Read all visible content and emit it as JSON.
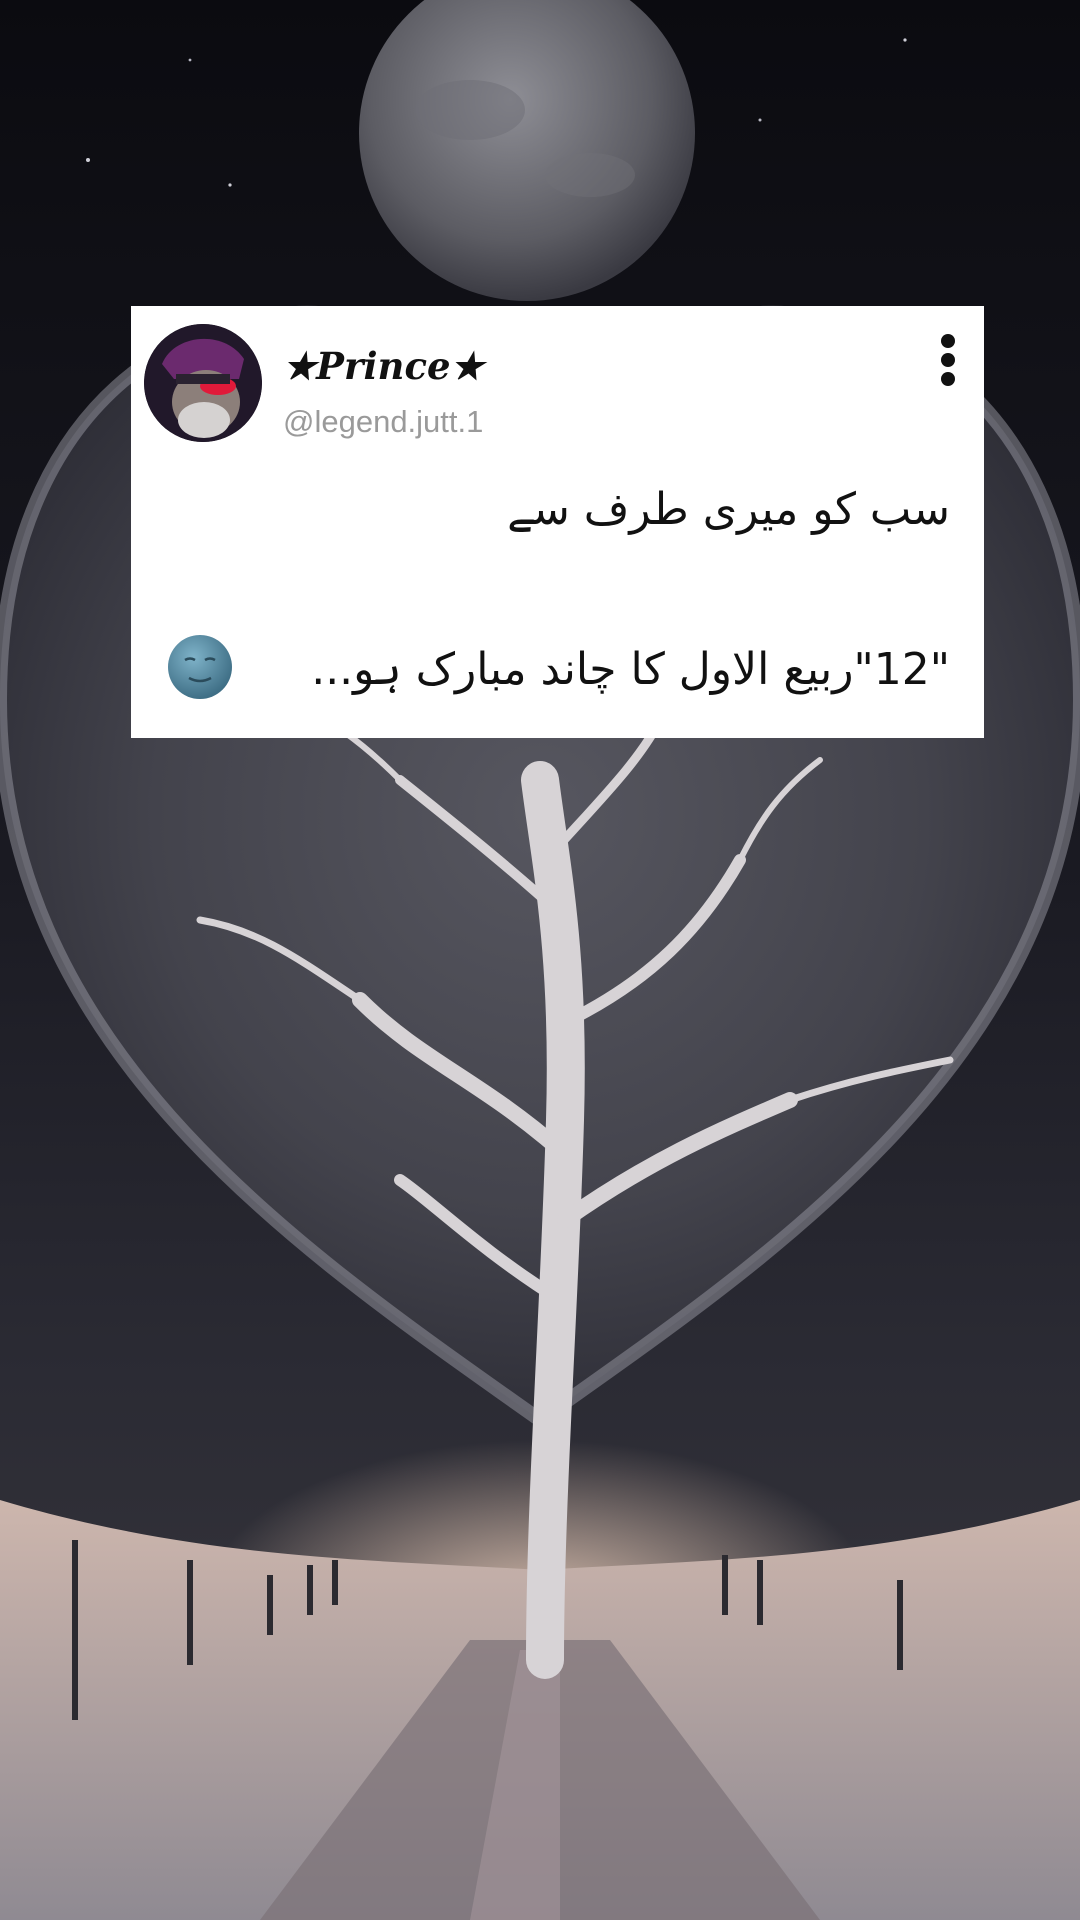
{
  "post": {
    "display_name": "★Prince★",
    "handle": "@legend.jutt.1",
    "line1": "سب کو میری طرف سے",
    "line2": "\"12\"ربیع الاول کا چاند مبارک ہو...",
    "emoji": "new-moon-face-emoji",
    "menu_icon": "vertical-dots-icon"
  },
  "colors": {
    "card_bg": "#ffffff",
    "text": "#111111",
    "handle_text": "#9a9a9a",
    "sky": "#0d0d12"
  }
}
